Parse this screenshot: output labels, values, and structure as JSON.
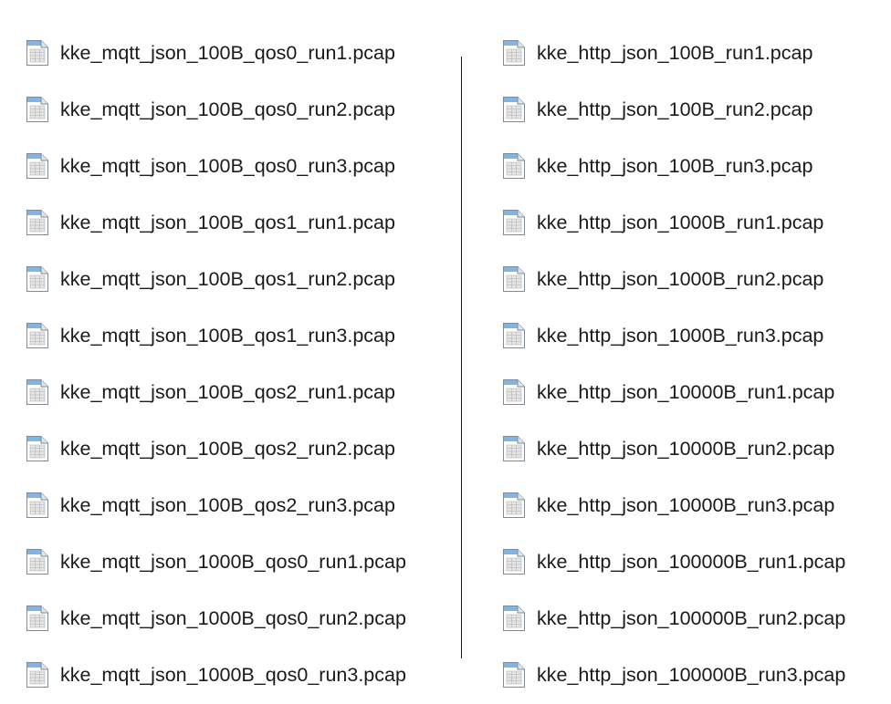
{
  "icon": "pcap-file-icon",
  "left_column": [
    {
      "name": "kke_mqtt_json_100B_qos0_run1.pcap"
    },
    {
      "name": "kke_mqtt_json_100B_qos0_run2.pcap"
    },
    {
      "name": "kke_mqtt_json_100B_qos0_run3.pcap"
    },
    {
      "name": "kke_mqtt_json_100B_qos1_run1.pcap"
    },
    {
      "name": "kke_mqtt_json_100B_qos1_run2.pcap"
    },
    {
      "name": "kke_mqtt_json_100B_qos1_run3.pcap"
    },
    {
      "name": "kke_mqtt_json_100B_qos2_run1.pcap"
    },
    {
      "name": "kke_mqtt_json_100B_qos2_run2.pcap"
    },
    {
      "name": "kke_mqtt_json_100B_qos2_run3.pcap"
    },
    {
      "name": "kke_mqtt_json_1000B_qos0_run1.pcap"
    },
    {
      "name": "kke_mqtt_json_1000B_qos0_run2.pcap"
    },
    {
      "name": "kke_mqtt_json_1000B_qos0_run3.pcap"
    }
  ],
  "right_column": [
    {
      "name": "kke_http_json_100B_run1.pcap"
    },
    {
      "name": "kke_http_json_100B_run2.pcap"
    },
    {
      "name": "kke_http_json_100B_run3.pcap"
    },
    {
      "name": "kke_http_json_1000B_run1.pcap"
    },
    {
      "name": "kke_http_json_1000B_run2.pcap"
    },
    {
      "name": "kke_http_json_1000B_run3.pcap"
    },
    {
      "name": "kke_http_json_10000B_run1.pcap"
    },
    {
      "name": "kke_http_json_10000B_run2.pcap"
    },
    {
      "name": "kke_http_json_10000B_run3.pcap"
    },
    {
      "name": "kke_http_json_100000B_run1.pcap"
    },
    {
      "name": "kke_http_json_100000B_run2.pcap"
    },
    {
      "name": "kke_http_json_100000B_run3.pcap"
    }
  ]
}
